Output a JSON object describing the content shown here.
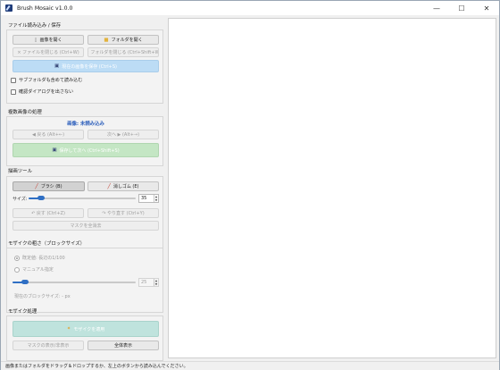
{
  "window": {
    "title": "Brush Mosaic v1.0.0",
    "controls": {
      "minimize": "—",
      "maximize": "☐",
      "close": "✕"
    }
  },
  "file_section": {
    "title": "ファイル読み込み / 保存",
    "open_image": "画像を開く",
    "open_folder": "フォルダを開く",
    "close_file": "× ファイルを閉じる (Ctrl+W)",
    "close_folder": "× フォルダを閉じる (Ctrl+Shift+W)",
    "save_image": "現在の画像を保存 (Ctrl+S)",
    "include_subfolders": "サブフォルダも含めて読み込む",
    "no_confirm_dialog": "確認ダイアログを出さない"
  },
  "multi_section": {
    "title": "複数画像の処理",
    "status": "画像: 未読み込み",
    "prev": "◀ 戻る (Alt+←)",
    "next": "次へ ▶ (Alt+→)",
    "save_next": "保存して次へ (Ctrl+Shift+S)"
  },
  "draw_section": {
    "title": "描画ツール",
    "brush": "ブラシ (B)",
    "eraser": "消しゴム (E)",
    "size_label": "サイズ:",
    "size_value": "35",
    "size_level": 0.12,
    "undo": "↶ 戻す (Ctrl+Z)",
    "redo": "↷ やり直す (Ctrl+Y)",
    "clear_mask": "マスクを全消去"
  },
  "grain_section": {
    "title": "モザイクの粗さ（ブロックサイズ）",
    "auto_option": "既定値: 長辺の1/100",
    "manual_option": "マニュアル指定",
    "manual_value": "25",
    "manual_level": 0.1,
    "current_block": "現在のブロックサイズ: - px"
  },
  "mosaic_section": {
    "title": "モザイク処理",
    "apply": "モザイクを適用",
    "toggle_mask": "マスクの表示/非表示",
    "fit_view": "全体表示"
  },
  "statusbar": {
    "text": "画像またはフォルダをドラッグ＆ドロップするか、左上のボタンから読み込んでください。"
  },
  "colors": {
    "accent_blue": "#2f6fc4",
    "save_button": "#bcdcf5",
    "save_next_button": "#c4e6c4",
    "apply_button": "#bfe3dd",
    "status_text_blue": "#2a5dbb"
  },
  "icons": {
    "app": "brush-mosaic-app-icon",
    "open_image": "image-file-icon",
    "open_folder": "folder-icon",
    "save": "floppy-disk-icon",
    "brush": "pencil-icon",
    "eraser": "eraser-icon",
    "apply": "sparkle-icon"
  }
}
